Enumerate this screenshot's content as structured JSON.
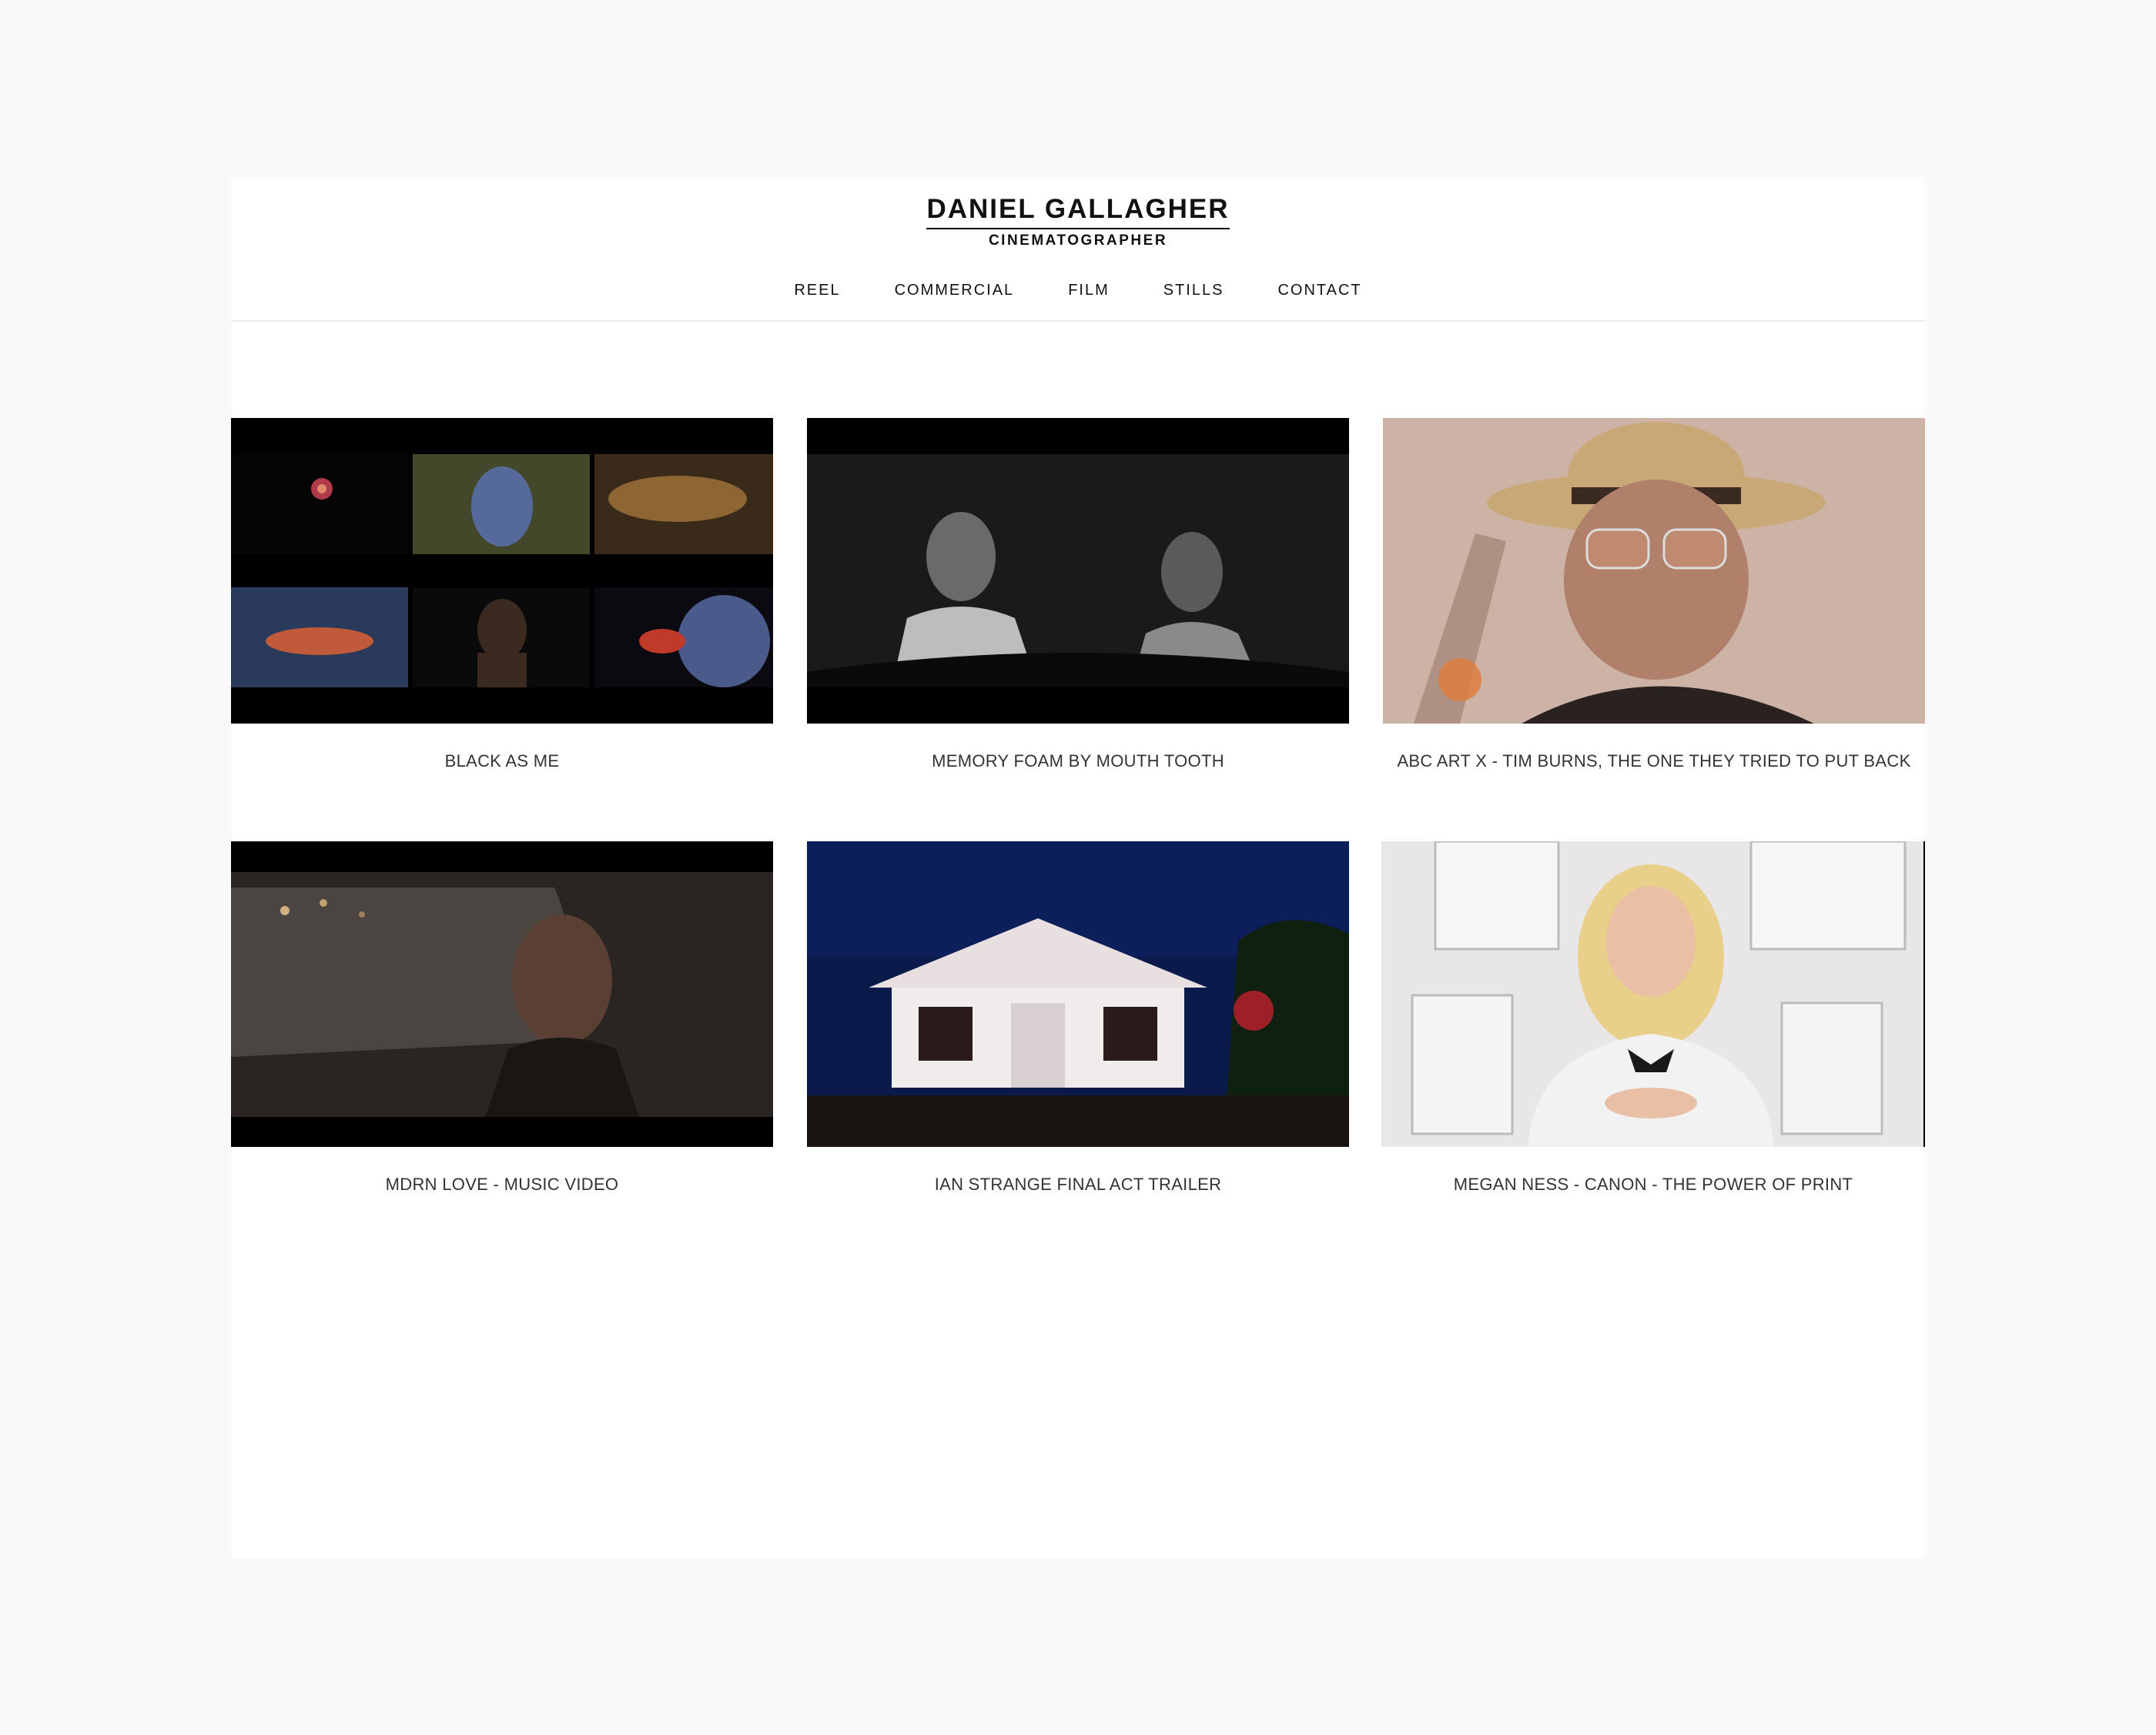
{
  "site": {
    "name": "DANIEL GALLAGHER",
    "tagline": "CINEMATOGRAPHER"
  },
  "nav": {
    "items": [
      {
        "label": "REEL"
      },
      {
        "label": "COMMERCIAL"
      },
      {
        "label": "FILM"
      },
      {
        "label": "STILLS"
      },
      {
        "label": "CONTACT"
      }
    ]
  },
  "projects": [
    {
      "title": "BLACK AS ME"
    },
    {
      "title": "MEMORY FOAM BY MOUTH TOOTH"
    },
    {
      "title": "ABC ART X - TIM BURNS, THE ONE THEY TRIED TO PUT BACK"
    },
    {
      "title": "MDRN LOVE - MUSIC VIDEO"
    },
    {
      "title": "IAN STRANGE FINAL ACT TRAILER"
    },
    {
      "title": "MEGAN NESS - CANON - THE POWER OF PRINT"
    }
  ]
}
